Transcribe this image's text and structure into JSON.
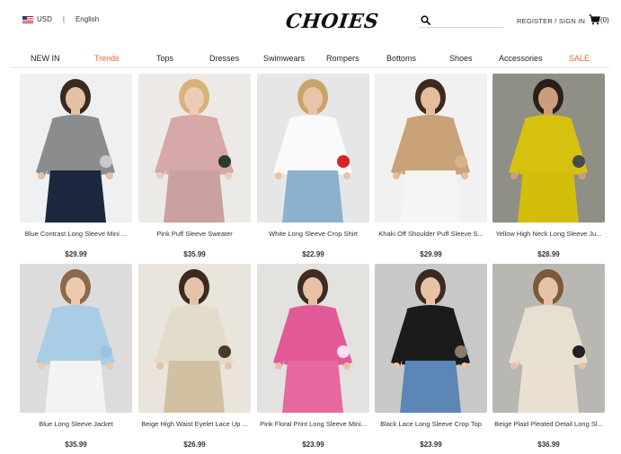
{
  "header": {
    "currency": "USD",
    "language": "English",
    "logo": "CHOIES",
    "search": {
      "placeholder": "",
      "value": ""
    },
    "register_label": "REGISTER",
    "account_separator": "/",
    "signin_label": "SIGN IN",
    "cart_count": "(0)"
  },
  "nav": {
    "items": [
      {
        "label": "NEW IN"
      },
      {
        "label": "Trends"
      },
      {
        "label": "Tops"
      },
      {
        "label": "Dresses"
      },
      {
        "label": "Swimwears"
      },
      {
        "label": "Rompers"
      },
      {
        "label": "Bottoms"
      },
      {
        "label": "Shoes"
      },
      {
        "label": "Accessories"
      },
      {
        "label": "SALE"
      }
    ],
    "accent_color": "#e8643c"
  },
  "products": [
    {
      "name": "Blue Contrast Long Sleeve Mini ...",
      "price": "$29.99",
      "colors": {
        "bg": "#eef0f2",
        "top": "#8a8c8e",
        "body": "#1e2740",
        "skin": "#e4c0a4",
        "hair": "#3a2a20",
        "acc": "#c7c9cc"
      }
    },
    {
      "name": "Pink Puff Sleeve Sweater",
      "price": "$35.99",
      "colors": {
        "bg": "#ece9e6",
        "top": "#d6a8a8",
        "body": "#caa0a0",
        "skin": "#ebcdb6",
        "hair": "#d7b37a",
        "acc": "#2d3b2c"
      }
    },
    {
      "name": "White Long Sleeve Crop Shirt",
      "price": "$22.99",
      "colors": {
        "bg": "#e6e6e6",
        "top": "#fafafa",
        "body": "#8ab2cf",
        "skin": "#e8c4a8",
        "hair": "#c9a46a",
        "acc": "#d62424"
      }
    },
    {
      "name": "Khaki Off Shoulder Puff Sleeve S...",
      "price": "$29.99",
      "colors": {
        "bg": "#f1f1f1",
        "top": "#caa277",
        "body": "#f5f5f3",
        "skin": "#e5bd9c",
        "hair": "#3d2a1e",
        "acc": "#d9b287"
      }
    },
    {
      "name": "Yellow High Neck Long Sleeve Ju...",
      "price": "$28.99",
      "colors": {
        "bg": "#8f8f86",
        "top": "#d6c20e",
        "body": "#d4be0c",
        "skin": "#c99e7e",
        "hair": "#2b1f17",
        "acc": "#4a4a4a"
      }
    },
    {
      "name": "Blue Long Sleeve Jacket",
      "price": "$35.99",
      "colors": {
        "bg": "#dcdcdc",
        "top": "#a9cde4",
        "body": "#f3f3f3",
        "skin": "#eccab0",
        "hair": "#8a6a4a",
        "acc": "#9bc3de"
      }
    },
    {
      "name": "Beige High Waist Eyelet Lace Up ...",
      "price": "$26.99",
      "colors": {
        "bg": "#e9e4dc",
        "top": "#e4dccb",
        "body": "#d2c0a2",
        "skin": "#e6c3a8",
        "hair": "#3a2a1f",
        "acc": "#4a3a2a"
      }
    },
    {
      "name": "Pink Floral Print Long Sleeve Mini...",
      "price": "$23.99",
      "colors": {
        "bg": "#e4e2df",
        "top": "#e35a98",
        "body": "#e8679f",
        "skin": "#e7c1a5",
        "hair": "#3f2c20",
        "acc": "#fbe1ef"
      }
    },
    {
      "name": "Black Lace Long Sleeve Crop Top",
      "price": "$23.99",
      "colors": {
        "bg": "#c8c8c8",
        "top": "#1b1b1b",
        "body": "#5b86b5",
        "skin": "#e8c3a6",
        "hair": "#3b2a20",
        "acc": "#8a7a6a"
      }
    },
    {
      "name": "Beige Plaid Pleated Detail Long Sl...",
      "price": "$36.99",
      "colors": {
        "bg": "#b9b7b2",
        "top": "#e7dfcf",
        "body": "#e9e0cf",
        "skin": "#e6c3a6",
        "hair": "#7a5a3a",
        "acc": "#222222"
      }
    }
  ]
}
